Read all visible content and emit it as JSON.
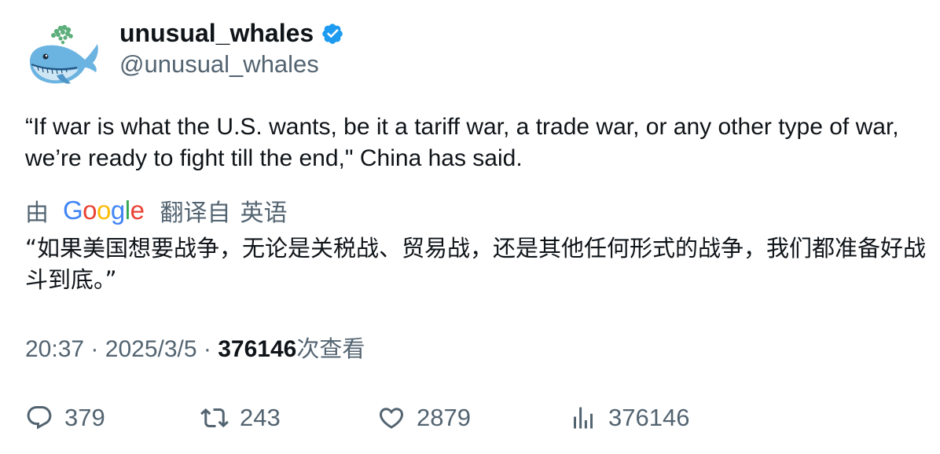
{
  "author": {
    "display_name": "unusual_whales",
    "handle": "@unusual_whales",
    "verified": true,
    "avatar_icon": "whale-icon"
  },
  "tweet": {
    "text": "“If war is what the U.S. wants, be it a tariff war, a trade war, or any other type of war, we’re ready to fight till the end,\" China has said."
  },
  "translation": {
    "by_label": "由",
    "provider": "Google",
    "from_label": "翻译自",
    "language": "英语",
    "text": "“如果美国想要战争，无论是关税战、贸易战，还是其他任何形式的战争，我们都准备好战斗到底。”"
  },
  "meta": {
    "time": "20:37",
    "separator": "·",
    "date": "2025/3/5",
    "views_count": "376146",
    "views_label": "次查看"
  },
  "actions": {
    "replies": "379",
    "retweets": "243",
    "likes": "2879",
    "views": "376146"
  },
  "colors": {
    "text_primary": "#0f1419",
    "text_secondary": "#536471",
    "verified_blue": "#1d9bf0"
  }
}
